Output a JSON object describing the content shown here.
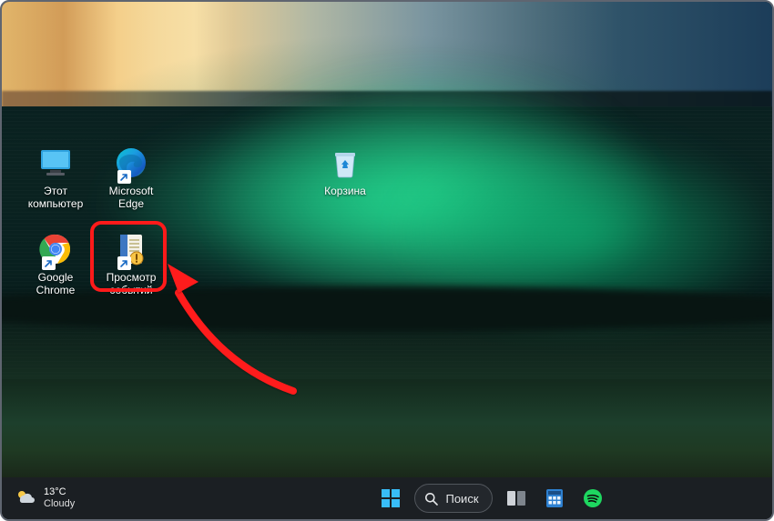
{
  "colors": {
    "highlight": "#ff1a1a",
    "taskbar_bg": "#1b1f23",
    "accent_green": "#1ee8a0"
  },
  "desktop": {
    "icons": {
      "this_pc": {
        "label": "Этот\nкомпьютер",
        "icon": "monitor-icon"
      },
      "edge": {
        "label": "Microsoft\nEdge",
        "icon": "edge-icon"
      },
      "chrome": {
        "label": "Google\nChrome",
        "icon": "chrome-icon"
      },
      "eventvwr": {
        "label": "Просмотр\nсобытий",
        "icon": "event-viewer-icon"
      },
      "recycle": {
        "label": "Корзина",
        "icon": "recycle-bin-icon"
      }
    },
    "highlighted_icon": "eventvwr"
  },
  "taskbar": {
    "weather": {
      "temp": "13°C",
      "condition": "Cloudy"
    },
    "search_placeholder": "Поиск"
  }
}
